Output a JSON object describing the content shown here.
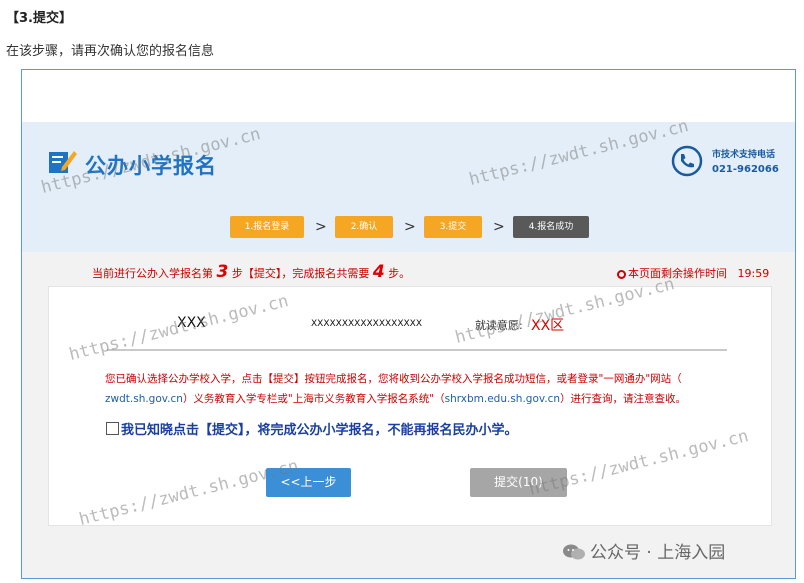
{
  "doc": {
    "step_heading": "【3.提交】",
    "intro": "在该步骤，请再次确认您的报名信息"
  },
  "header": {
    "title": "公办小学报名",
    "support_label": "市技术支持电话",
    "support_phone": "021-962066"
  },
  "progress": {
    "steps": [
      "1.报名登录",
      "2.确认",
      "3.提交",
      "4.报名成功"
    ],
    "arrow": ">"
  },
  "instruction": {
    "prefix": "当前进行公办入学报名第",
    "step_no": "3",
    "middle": "步【提交】，完成报名共需要",
    "total": "4",
    "suffix": "步。"
  },
  "timer": {
    "label": "本页面剩余操作时间",
    "value": "19:59"
  },
  "applicant": {
    "name": "XXX",
    "id_number": "XXXXXXXXXXXXXXXXXX",
    "intent_label": "就读意愿:",
    "intent_value": "XX区"
  },
  "notice": {
    "line1": "您已确认选择公办学校入学，点击【提交】按钮完成报名，您将收到公办学校入学报名成功短信，或者登录\"一网通办\"网站（",
    "line2_url1": "zwdt.sh.gov.cn",
    "line2_mid": "）义务教育入学专栏或\"上海市义务教育入学报名系统\"（",
    "line2_url2": "shrxbm.edu.sh.gov.cn",
    "line2_end": "）进行查询，请注意查收。"
  },
  "confirm_checkbox": {
    "label": "我已知晓点击【提交】，将完成公办小学报名，不能再报名民办小学。"
  },
  "buttons": {
    "prev": "<<上一步",
    "submit": "提交(10)"
  },
  "watermark": {
    "text": "https://zwdt.sh.gov.cn"
  },
  "footer": {
    "wechat_label": "公众号 · 上海入园"
  },
  "colors": {
    "brand_blue": "#1f73c2",
    "step_active": "#f5a623",
    "step_pending": "#595959",
    "alert_red": "#cc0000",
    "prev_button": "#3b8fd6",
    "submit_disabled": "#a6a6a6"
  }
}
